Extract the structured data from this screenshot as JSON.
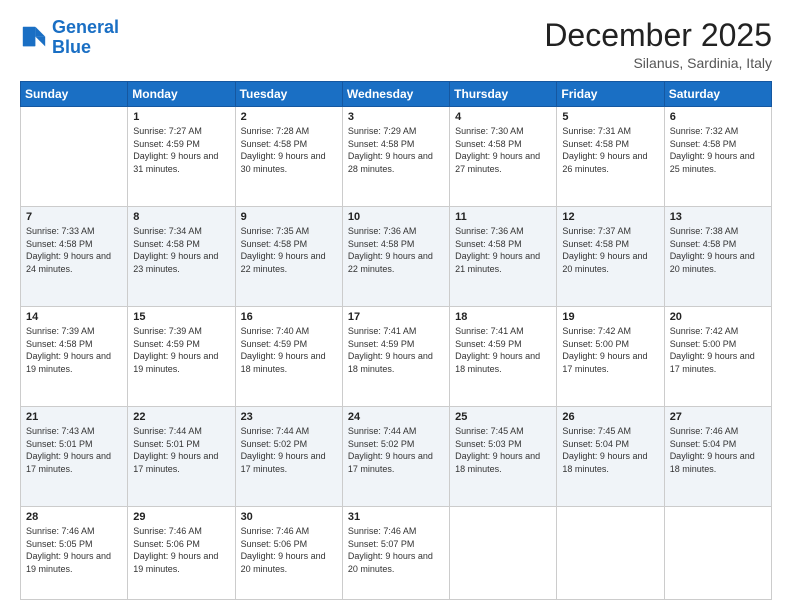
{
  "header": {
    "logo_line1": "General",
    "logo_line2": "Blue",
    "month": "December 2025",
    "location": "Silanus, Sardinia, Italy"
  },
  "days_of_week": [
    "Sunday",
    "Monday",
    "Tuesday",
    "Wednesday",
    "Thursday",
    "Friday",
    "Saturday"
  ],
  "weeks": [
    [
      {
        "day": "",
        "sunrise": "",
        "sunset": "",
        "daylight": ""
      },
      {
        "day": "1",
        "sunrise": "Sunrise: 7:27 AM",
        "sunset": "Sunset: 4:59 PM",
        "daylight": "Daylight: 9 hours and 31 minutes."
      },
      {
        "day": "2",
        "sunrise": "Sunrise: 7:28 AM",
        "sunset": "Sunset: 4:58 PM",
        "daylight": "Daylight: 9 hours and 30 minutes."
      },
      {
        "day": "3",
        "sunrise": "Sunrise: 7:29 AM",
        "sunset": "Sunset: 4:58 PM",
        "daylight": "Daylight: 9 hours and 28 minutes."
      },
      {
        "day": "4",
        "sunrise": "Sunrise: 7:30 AM",
        "sunset": "Sunset: 4:58 PM",
        "daylight": "Daylight: 9 hours and 27 minutes."
      },
      {
        "day": "5",
        "sunrise": "Sunrise: 7:31 AM",
        "sunset": "Sunset: 4:58 PM",
        "daylight": "Daylight: 9 hours and 26 minutes."
      },
      {
        "day": "6",
        "sunrise": "Sunrise: 7:32 AM",
        "sunset": "Sunset: 4:58 PM",
        "daylight": "Daylight: 9 hours and 25 minutes."
      }
    ],
    [
      {
        "day": "7",
        "sunrise": "Sunrise: 7:33 AM",
        "sunset": "Sunset: 4:58 PM",
        "daylight": "Daylight: 9 hours and 24 minutes."
      },
      {
        "day": "8",
        "sunrise": "Sunrise: 7:34 AM",
        "sunset": "Sunset: 4:58 PM",
        "daylight": "Daylight: 9 hours and 23 minutes."
      },
      {
        "day": "9",
        "sunrise": "Sunrise: 7:35 AM",
        "sunset": "Sunset: 4:58 PM",
        "daylight": "Daylight: 9 hours and 22 minutes."
      },
      {
        "day": "10",
        "sunrise": "Sunrise: 7:36 AM",
        "sunset": "Sunset: 4:58 PM",
        "daylight": "Daylight: 9 hours and 22 minutes."
      },
      {
        "day": "11",
        "sunrise": "Sunrise: 7:36 AM",
        "sunset": "Sunset: 4:58 PM",
        "daylight": "Daylight: 9 hours and 21 minutes."
      },
      {
        "day": "12",
        "sunrise": "Sunrise: 7:37 AM",
        "sunset": "Sunset: 4:58 PM",
        "daylight": "Daylight: 9 hours and 20 minutes."
      },
      {
        "day": "13",
        "sunrise": "Sunrise: 7:38 AM",
        "sunset": "Sunset: 4:58 PM",
        "daylight": "Daylight: 9 hours and 20 minutes."
      }
    ],
    [
      {
        "day": "14",
        "sunrise": "Sunrise: 7:39 AM",
        "sunset": "Sunset: 4:58 PM",
        "daylight": "Daylight: 9 hours and 19 minutes."
      },
      {
        "day": "15",
        "sunrise": "Sunrise: 7:39 AM",
        "sunset": "Sunset: 4:59 PM",
        "daylight": "Daylight: 9 hours and 19 minutes."
      },
      {
        "day": "16",
        "sunrise": "Sunrise: 7:40 AM",
        "sunset": "Sunset: 4:59 PM",
        "daylight": "Daylight: 9 hours and 18 minutes."
      },
      {
        "day": "17",
        "sunrise": "Sunrise: 7:41 AM",
        "sunset": "Sunset: 4:59 PM",
        "daylight": "Daylight: 9 hours and 18 minutes."
      },
      {
        "day": "18",
        "sunrise": "Sunrise: 7:41 AM",
        "sunset": "Sunset: 4:59 PM",
        "daylight": "Daylight: 9 hours and 18 minutes."
      },
      {
        "day": "19",
        "sunrise": "Sunrise: 7:42 AM",
        "sunset": "Sunset: 5:00 PM",
        "daylight": "Daylight: 9 hours and 17 minutes."
      },
      {
        "day": "20",
        "sunrise": "Sunrise: 7:42 AM",
        "sunset": "Sunset: 5:00 PM",
        "daylight": "Daylight: 9 hours and 17 minutes."
      }
    ],
    [
      {
        "day": "21",
        "sunrise": "Sunrise: 7:43 AM",
        "sunset": "Sunset: 5:01 PM",
        "daylight": "Daylight: 9 hours and 17 minutes."
      },
      {
        "day": "22",
        "sunrise": "Sunrise: 7:44 AM",
        "sunset": "Sunset: 5:01 PM",
        "daylight": "Daylight: 9 hours and 17 minutes."
      },
      {
        "day": "23",
        "sunrise": "Sunrise: 7:44 AM",
        "sunset": "Sunset: 5:02 PM",
        "daylight": "Daylight: 9 hours and 17 minutes."
      },
      {
        "day": "24",
        "sunrise": "Sunrise: 7:44 AM",
        "sunset": "Sunset: 5:02 PM",
        "daylight": "Daylight: 9 hours and 17 minutes."
      },
      {
        "day": "25",
        "sunrise": "Sunrise: 7:45 AM",
        "sunset": "Sunset: 5:03 PM",
        "daylight": "Daylight: 9 hours and 18 minutes."
      },
      {
        "day": "26",
        "sunrise": "Sunrise: 7:45 AM",
        "sunset": "Sunset: 5:04 PM",
        "daylight": "Daylight: 9 hours and 18 minutes."
      },
      {
        "day": "27",
        "sunrise": "Sunrise: 7:46 AM",
        "sunset": "Sunset: 5:04 PM",
        "daylight": "Daylight: 9 hours and 18 minutes."
      }
    ],
    [
      {
        "day": "28",
        "sunrise": "Sunrise: 7:46 AM",
        "sunset": "Sunset: 5:05 PM",
        "daylight": "Daylight: 9 hours and 19 minutes."
      },
      {
        "day": "29",
        "sunrise": "Sunrise: 7:46 AM",
        "sunset": "Sunset: 5:06 PM",
        "daylight": "Daylight: 9 hours and 19 minutes."
      },
      {
        "day": "30",
        "sunrise": "Sunrise: 7:46 AM",
        "sunset": "Sunset: 5:06 PM",
        "daylight": "Daylight: 9 hours and 20 minutes."
      },
      {
        "day": "31",
        "sunrise": "Sunrise: 7:46 AM",
        "sunset": "Sunset: 5:07 PM",
        "daylight": "Daylight: 9 hours and 20 minutes."
      },
      {
        "day": "",
        "sunrise": "",
        "sunset": "",
        "daylight": ""
      },
      {
        "day": "",
        "sunrise": "",
        "sunset": "",
        "daylight": ""
      },
      {
        "day": "",
        "sunrise": "",
        "sunset": "",
        "daylight": ""
      }
    ]
  ]
}
